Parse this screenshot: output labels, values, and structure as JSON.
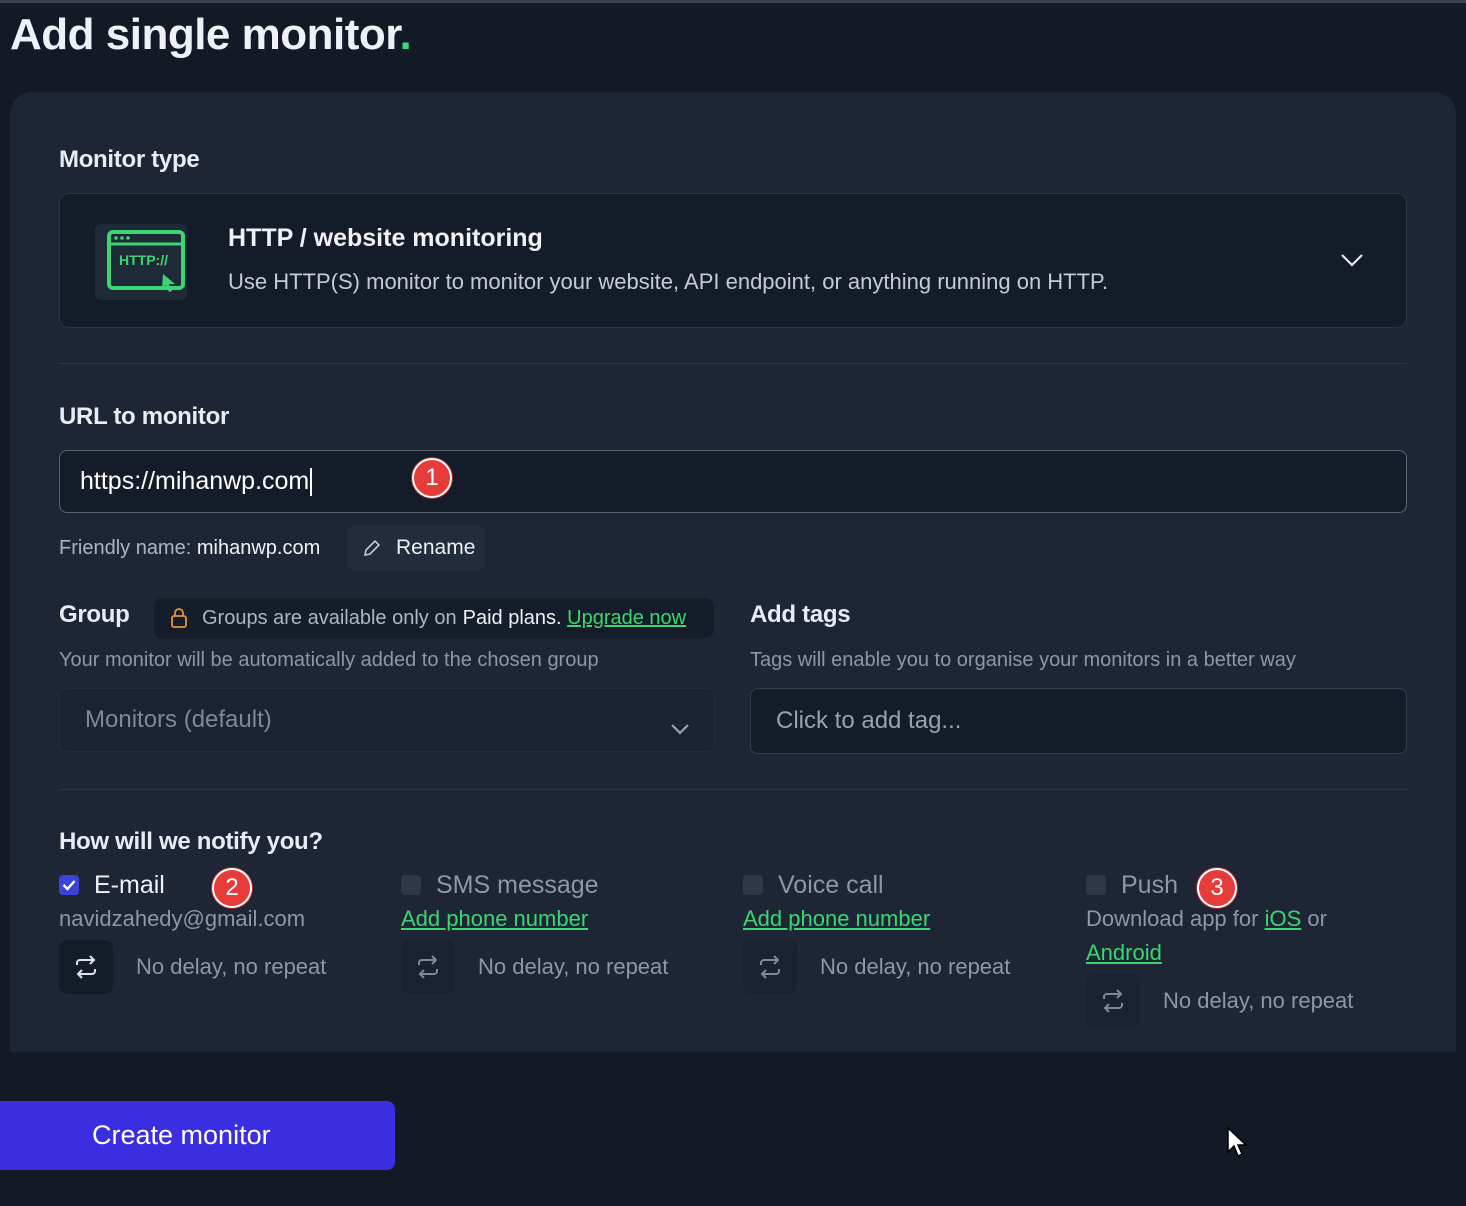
{
  "page": {
    "title": "Add single monitor",
    "title_dot": "."
  },
  "monitor_type": {
    "label": "Monitor type",
    "selected_title": "HTTP / website monitoring",
    "selected_description": "Use HTTP(S) monitor to monitor your website, API endpoint, or anything running on HTTP.",
    "icon_text": "HTTP://",
    "icon": "http-icon"
  },
  "url": {
    "label": "URL to monitor",
    "value": "https://mihanwp.com"
  },
  "friendly_name": {
    "prefix": "Friendly name:",
    "value": "mihanwp.com",
    "rename_label": "Rename"
  },
  "group": {
    "label": "Group",
    "note_text": "Groups are available only on",
    "note_strong": "Paid plans",
    "note_period": ".",
    "upgrade_link": "Upgrade now",
    "help": "Your monitor will be automatically added to the chosen group",
    "selected": "Monitors (default)"
  },
  "tags": {
    "label": "Add tags",
    "help": "Tags will enable you to organise your monitors in a better way",
    "placeholder": "Click to add tag..."
  },
  "notify": {
    "label": "How will we notify you?",
    "email": {
      "label": "E-mail",
      "checked": true,
      "address": "navidzahedy@gmail.com",
      "repeat": "No delay, no repeat"
    },
    "sms": {
      "label": "SMS message",
      "checked": false,
      "link": "Add phone number",
      "repeat": "No delay, no repeat"
    },
    "voice": {
      "label": "Voice call",
      "checked": false,
      "link": "Add phone number",
      "repeat": "No delay, no repeat"
    },
    "push": {
      "label": "Push",
      "checked": false,
      "text_prefix": "Download app for",
      "ios_link": "iOS",
      "text_mid": "or",
      "android_link": "Android",
      "repeat": "No delay, no repeat"
    }
  },
  "annotations": [
    "1",
    "2",
    "3"
  ],
  "create_button": "Create monitor",
  "colors": {
    "background": "#131a26",
    "card": "#1e2636",
    "accent_green": "#3bd671",
    "primary_button": "#3b2ee0",
    "annotation_red": "#e63b3b"
  }
}
